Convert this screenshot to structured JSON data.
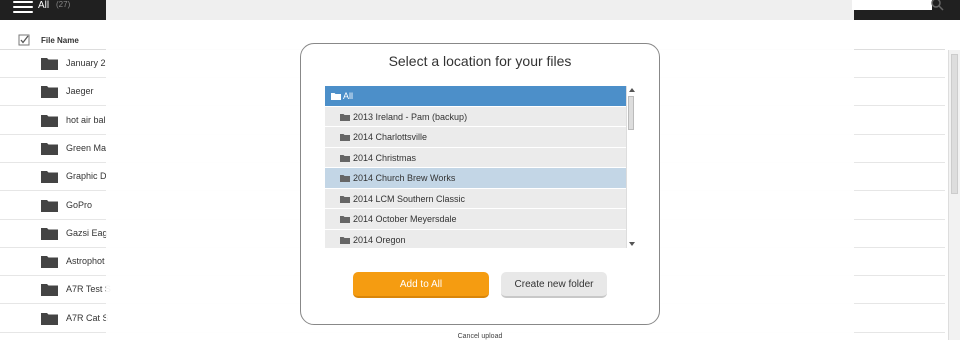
{
  "app": {
    "folder_title": "All",
    "folder_count": "(27)",
    "file_header": "File Name",
    "files": [
      "January 2",
      "Jaeger",
      "hot air bal",
      "Green Ma",
      "Graphic D",
      "GoPro",
      "Gazsi Eag",
      "Astrophot",
      "A7R Test S",
      "A7R Cat S"
    ]
  },
  "dialog": {
    "title": "Select a location for your files",
    "root_item": "All",
    "folders": [
      "2013 Ireland - Pam (backup)",
      "2014 Charlottsville",
      "2014 Christmas",
      "2014 Church Brew Works",
      "2014 LCM Southern Classic",
      "2014 October Meyersdale",
      "2014 Oregon"
    ],
    "highlighted_index": 3,
    "add_button": "Add to All",
    "create_button": "Create new folder",
    "cancel_link": "Cancel upload"
  },
  "colors": {
    "accent_orange": "#f59c11",
    "selection_blue": "#4c8fc9",
    "hover_blue": "#c3d6e6",
    "topbar": "#202020"
  },
  "icons": {
    "menu": "hamburger-icon",
    "search": "search-icon",
    "folder": "folder-icon",
    "checkbox": "checkbox-icon"
  }
}
